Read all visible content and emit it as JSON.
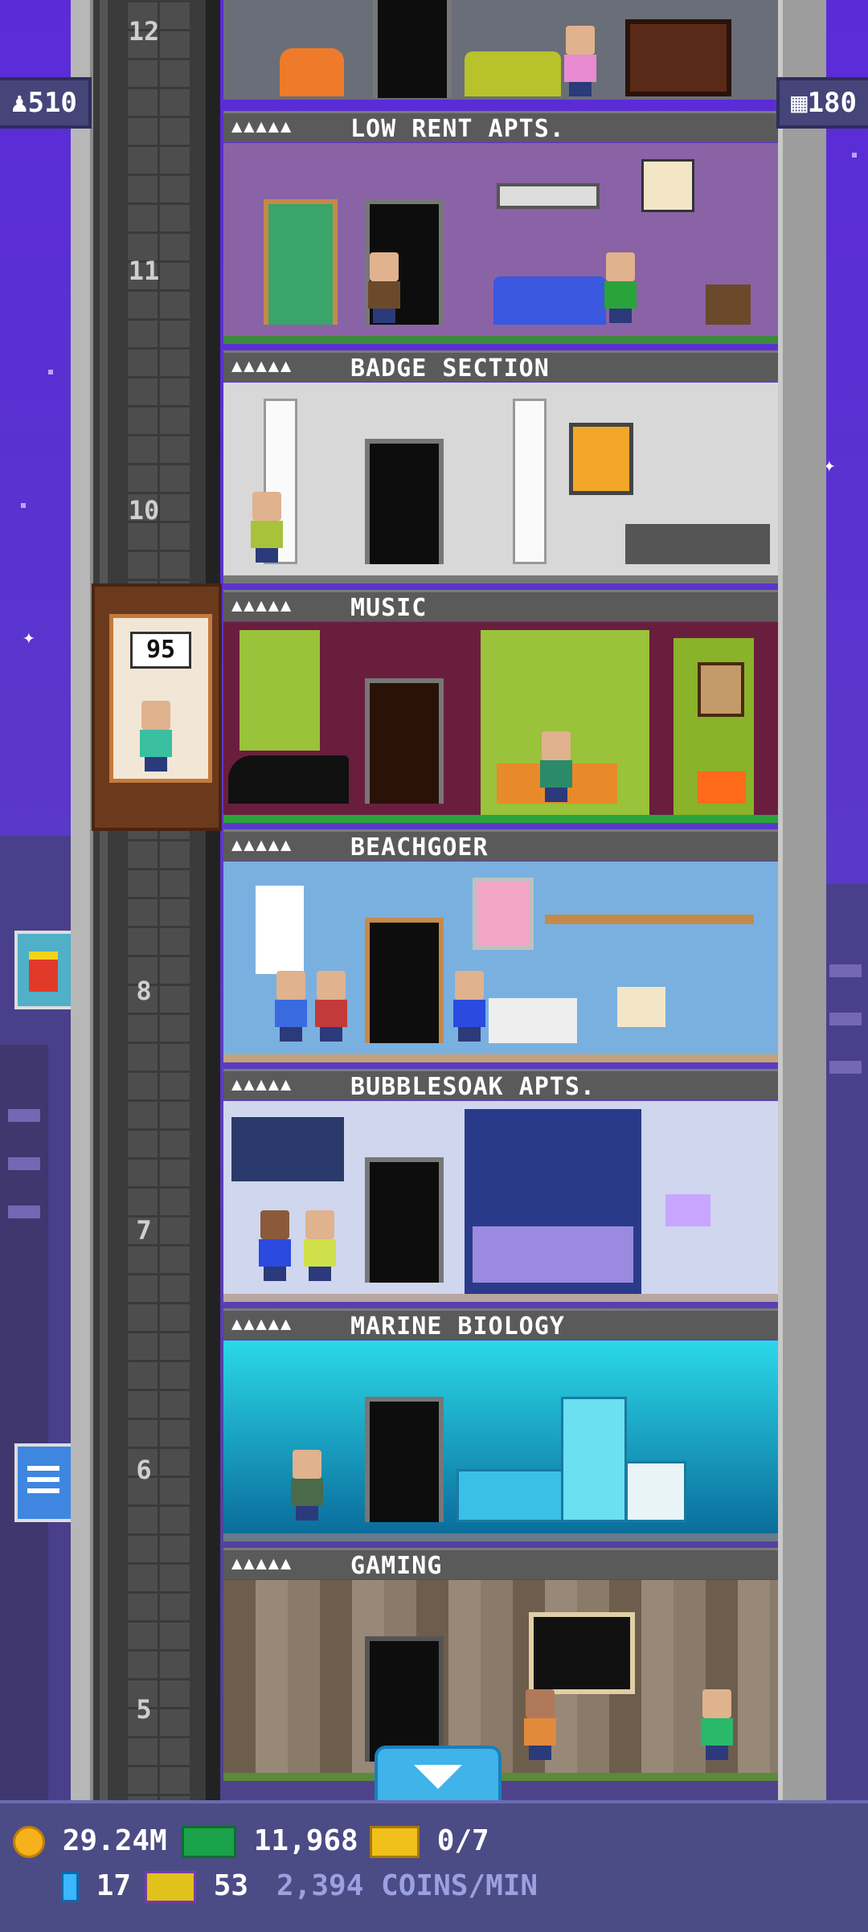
{
  "top_counters": {
    "population": "510",
    "floors": "180"
  },
  "elevator": {
    "floor_number": "95"
  },
  "floor_numbers": [
    "12",
    "11",
    "10",
    "8",
    "7",
    "6",
    "5"
  ],
  "floors": [
    {
      "people": "▲▲▲▲▲",
      "name": "LOW RENT APTS."
    },
    {
      "people": "▲▲▲▲▲",
      "name": "BADGE SECTION"
    },
    {
      "people": "▲▲▲▲▲",
      "name": "MUSIC"
    },
    {
      "people": "▲▲▲▲▲",
      "name": "BEACHGOER"
    },
    {
      "people": "▲▲▲▲▲",
      "name": "BUBBLESOAK APTS."
    },
    {
      "people": "▲▲▲▲▲",
      "name": "MARINE BIOLOGY"
    },
    {
      "people": "▲▲▲▲▲",
      "name": "GAMING"
    }
  ],
  "hud": {
    "coins": "29.24M",
    "bux": "11,968",
    "tickets": "0/7",
    "gems": "17",
    "vip": "53",
    "rate": "2,394 COINS/MIN"
  },
  "icons": {
    "population": "person-icon",
    "floors": "building-icon",
    "coins": "coin-icon",
    "bux": "bux-icon",
    "tickets": "ticket-icon",
    "gems": "gem-icon",
    "vip": "vip-ticket-icon",
    "scroll": "chevron-down-icon"
  },
  "colors": {
    "sky": "#5b2bd8",
    "hud": "#4b4b86",
    "scroll_button": "#3fb3ea"
  }
}
